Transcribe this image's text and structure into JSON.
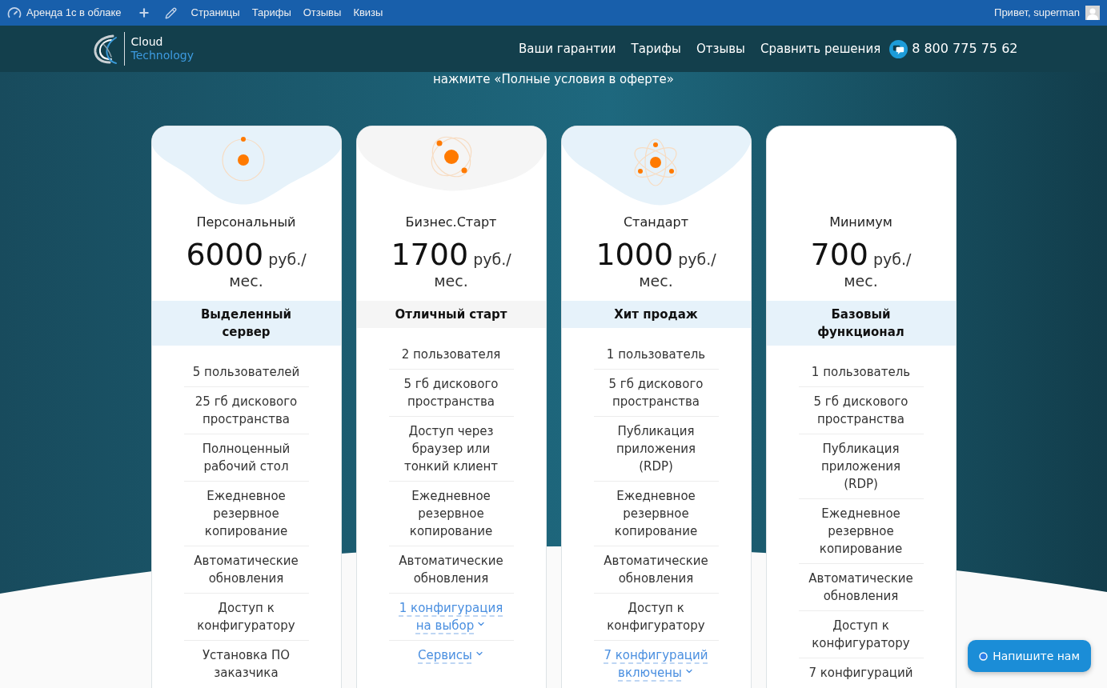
{
  "admin_bar": {
    "site_title": "Аренда 1с в облаке",
    "menu": [
      {
        "label": "Страницы"
      },
      {
        "label": "Тарифы"
      },
      {
        "label": "Отзывы"
      },
      {
        "label": "Квизы"
      }
    ],
    "greeting": "Привет, superman"
  },
  "header": {
    "logo": {
      "line_1": "Cloud",
      "line_2": "Technology"
    },
    "nav": [
      {
        "label": "Ваши гарантии"
      },
      {
        "label": "Тарифы"
      },
      {
        "label": "Отзывы"
      },
      {
        "label": "Сравнить решения"
      }
    ],
    "phone": "8 800 775 75 62"
  },
  "intro": {
    "text": "нажмите «Полные условия в оферте»"
  },
  "plans": [
    {
      "kind": "solo",
      "color": "#e6f2fa",
      "name": "Персональный",
      "price": "6000",
      "unit": "руб./ мес.",
      "tag": "Выделенный сервер",
      "features": [
        {
          "kind": "text",
          "label": "5 пользователей"
        },
        {
          "kind": "text",
          "label": "25 гб дискового пространства"
        },
        {
          "kind": "text",
          "label": "Полноценный рабочий стол"
        },
        {
          "kind": "text",
          "label": "Ежедневное резервное копирование"
        },
        {
          "kind": "text",
          "label": "Автоматические обновления"
        },
        {
          "kind": "text",
          "label": "Доступ к конфигуратору"
        },
        {
          "kind": "text",
          "label": "Установка ПО заказчика"
        }
      ]
    },
    {
      "kind": "pair",
      "color": "#f5f5f5",
      "name": "Бизнес.Старт",
      "price": "1700",
      "unit": "руб./ мес.",
      "tag": "Отличный старт",
      "features": [
        {
          "kind": "text",
          "label": "2 пользователя"
        },
        {
          "kind": "text",
          "label": "5 гб дискового пространства"
        },
        {
          "kind": "text",
          "label": "Доступ через браузер или тонкий клиент"
        },
        {
          "kind": "text",
          "label": "Ежедневное резервное копирование"
        },
        {
          "kind": "text",
          "label": "Автоматические обновления"
        },
        {
          "kind": "dropdown",
          "label": "1 конфигурация на выбор"
        },
        {
          "kind": "dropdown",
          "label": "Сервисы"
        }
      ]
    },
    {
      "kind": "trio",
      "color": "#e6f2fa",
      "name": "Стандарт",
      "price": "1000",
      "unit": "руб./ мес.",
      "tag": "Хит продаж",
      "features": [
        {
          "kind": "text",
          "label": "1 пользователь"
        },
        {
          "kind": "text",
          "label": "5 гб дискового пространства"
        },
        {
          "kind": "text",
          "label": "Публикация приложения (RDP)"
        },
        {
          "kind": "text",
          "label": "Ежедневное резервное копирование"
        },
        {
          "kind": "text",
          "label": "Автоматические обновления"
        },
        {
          "kind": "text",
          "label": "Доступ к конфигуратору"
        },
        {
          "kind": "dropdown",
          "label": "7 конфигураций включены"
        }
      ]
    },
    {
      "kind": "plain",
      "color": "#e6f2fa",
      "name": "Минимум",
      "price": "700",
      "unit": "руб./ мес.",
      "tag": "Базовый функционал",
      "features": [
        {
          "kind": "text",
          "label": "1 пользователь"
        },
        {
          "kind": "text",
          "label": "5 гб дискового пространства"
        },
        {
          "kind": "text",
          "label": "Публикация приложения (RDP)"
        },
        {
          "kind": "text",
          "label": "Ежедневное резервное копирование"
        },
        {
          "kind": "text",
          "label": "Автоматические обновления"
        },
        {
          "kind": "text",
          "label": "Доступ к конфигуратору"
        },
        {
          "kind": "text",
          "label": "7 конфигураций"
        }
      ]
    }
  ],
  "chat_button": {
    "label": "Напишите нам"
  }
}
